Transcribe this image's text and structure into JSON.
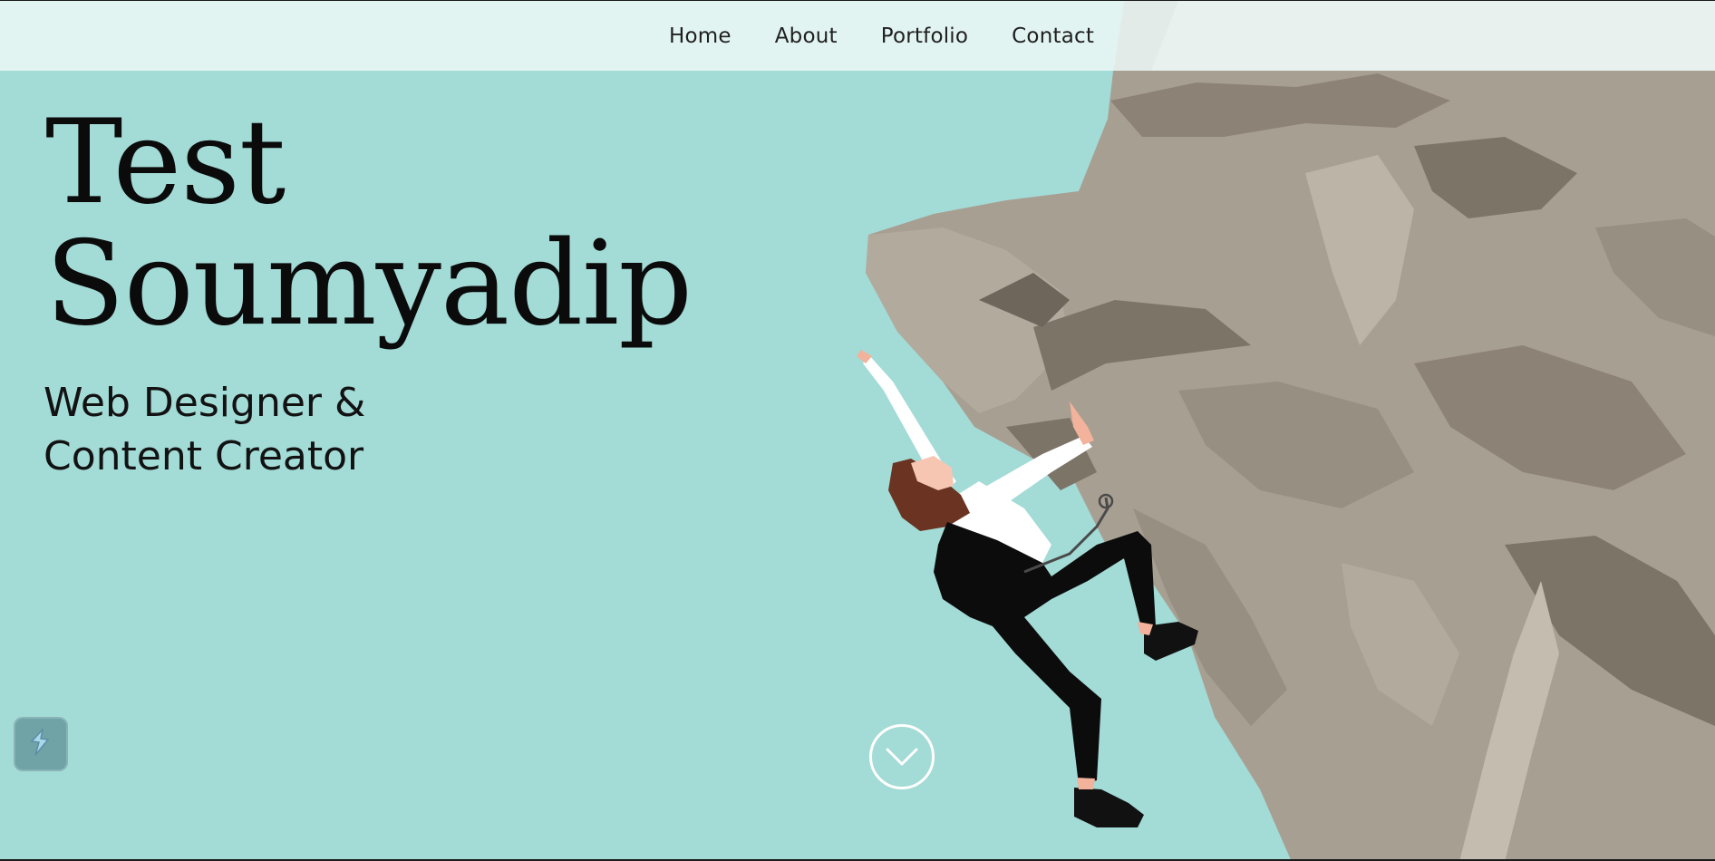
{
  "nav": {
    "items": [
      {
        "label": "Home"
      },
      {
        "label": "About"
      },
      {
        "label": "Portfolio"
      },
      {
        "label": "Contact"
      }
    ]
  },
  "hero": {
    "title_line1": "Test",
    "title_line2": "Soumyadip",
    "subtitle_line1": "Web Designer &",
    "subtitle_line2": "Content Creator"
  },
  "icons": {
    "scroll": "chevron-down-icon",
    "widget": "lightning-bolt-icon"
  },
  "colors": {
    "background": "#a3dbd6",
    "rock": "#a89f93",
    "rock_dark": "#7d7468",
    "text": "#0b0b0b",
    "nav_bg": "#ecf8f7"
  }
}
